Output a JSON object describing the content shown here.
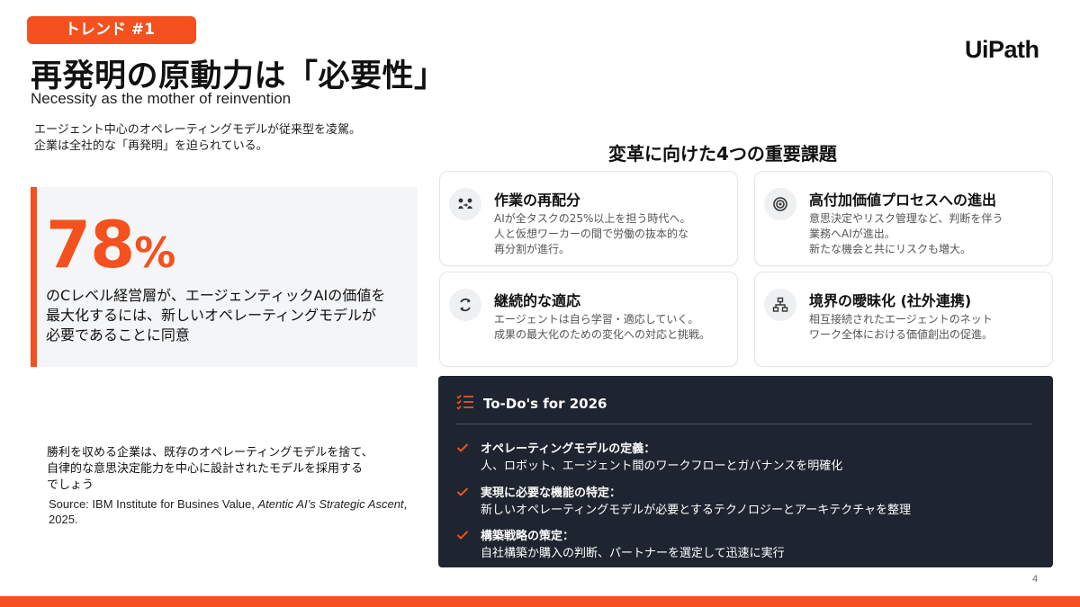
{
  "badge": {
    "label": "トレンド #1"
  },
  "header": {
    "title": "再発明の原動力は「必要性」",
    "subtitle": "Necessity as the mother of reinvention",
    "logo_text": "UiPath"
  },
  "intro": {
    "line1": "エージェント中心のオペレーティングモデルが従来型を凌駕。",
    "line2": "企業は全社的な「再発明」を迫られている。"
  },
  "stat": {
    "value": "78",
    "unit": "%",
    "line1": "のCレベル経営層が、エージェンティックAIの価値を",
    "line2": "最大化するには、新しいオペレーティングモデルが",
    "line3": "必要であることに同意"
  },
  "conclusion": {
    "line1": "勝利を収める企業は、既存のオペレーティングモデルを捨て、",
    "line2": "自律的な意思決定能力を中心に設計されたモデルを採用する",
    "line3": "でしょう"
  },
  "source": {
    "prefix": "Source: IBM Institute for Busines Value, ",
    "title": "Atentic AI’s Strategic Ascent",
    "suffix": ", 2025."
  },
  "challenges": {
    "title": "変革に向けた4つの重要課題",
    "cards": [
      {
        "icon": "people-exchange-icon",
        "title": "作業の再配分",
        "lines": [
          "AIが全タスクの25%以上を担う時代へ。",
          "人と仮想ワーカーの間で労働の抜本的な",
          "再分割が進行。"
        ]
      },
      {
        "icon": "target-icon",
        "title": "高付加価値プロセスへの進出",
        "lines": [
          "意思決定やリスク管理など、判断を伴う",
          "業務へAIが進出。",
          "新たな機会と共にリスクも増大。"
        ]
      },
      {
        "icon": "refresh-icon",
        "title": "継続的な適応",
        "lines": [
          "エージェントは自ら学習・適応していく。",
          "成果の最大化のための変化への対応と挑戦。"
        ]
      },
      {
        "icon": "network-icon",
        "title": "境界の曖昧化 (社外連携)",
        "lines": [
          "相互接続されたエージェントのネット",
          "ワーク全体における価値創出の促進。"
        ]
      }
    ]
  },
  "todo": {
    "title": "To-Do's for 2026",
    "items": [
      {
        "heading": "オペレーティングモデルの定義：",
        "detail": "人、ロボット、エージェント間のワークフローとガバナンスを明確化"
      },
      {
        "heading": "実現に必要な機能の特定：",
        "detail": "新しいオペレーティングモデルが必要とするテクノロジーとアーキテクチャを整理"
      },
      {
        "heading": "構築戦略の策定：",
        "detail": "自社構築か購入の判断、パートナーを選定して迅速に実行"
      }
    ]
  },
  "page_number": "4",
  "colors": {
    "accent": "#f4511e",
    "dark_panel": "#1e2530",
    "card_border": "#e3e5e8"
  }
}
